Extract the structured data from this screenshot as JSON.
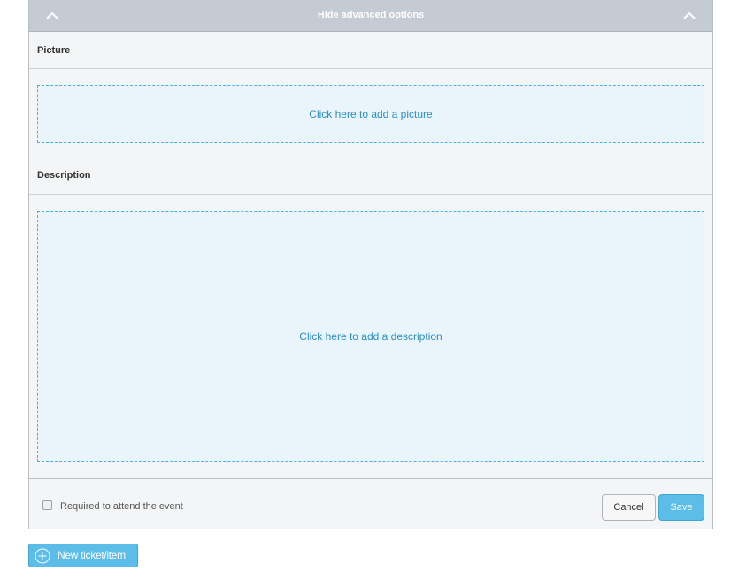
{
  "advanced": {
    "title": "Hide advanced options",
    "icon": "chevron-up-icon"
  },
  "picture": {
    "label": "Picture",
    "dropzone_text": "Click here to add a picture"
  },
  "description": {
    "label": "Description",
    "dropzone_text": "Click here to add a description"
  },
  "footer": {
    "required_label": "Required to attend the event",
    "required_checked": false,
    "cancel_label": "Cancel",
    "save_label": "Save"
  },
  "new_ticket": {
    "label": "New ticket/item",
    "icon": "plus-circle-icon"
  },
  "colors": {
    "accent": "#5bbde8",
    "header_bg": "#c5cbd2",
    "dropzone_bg": "#e9f5fb",
    "dropzone_border": "#45b2e0",
    "link_text": "#2a8fbd"
  }
}
